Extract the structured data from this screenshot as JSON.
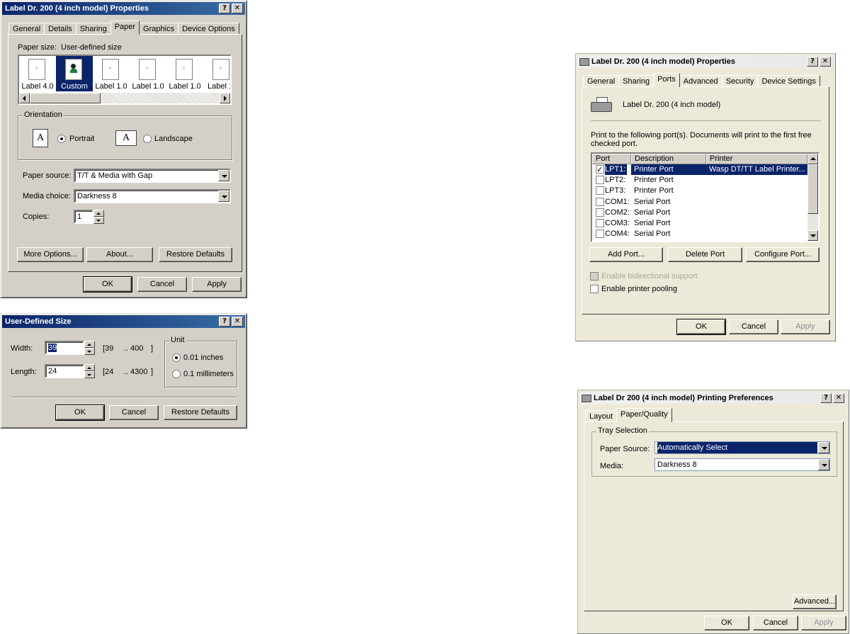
{
  "win1": {
    "title": "Label Dr. 200 (4 inch model) Properties",
    "help": "?",
    "close": "✕",
    "tabs": [
      "General",
      "Details",
      "Sharing",
      "Paper",
      "Graphics",
      "Device Options"
    ],
    "paper_size_label": "Paper size:",
    "paper_size_value": "User-defined size",
    "papers": [
      "Label 4.0",
      "Custom",
      "Label 1.0",
      "Label 1.0",
      "Label 1.0",
      "Label 1"
    ],
    "orientation_label": "Orientation",
    "portrait": "Portrait",
    "landscape": "Landscape",
    "orient_glyph": "A",
    "paper_source_label": "Paper source:",
    "paper_source_value": "T/T & Media with Gap",
    "media_label": "Media choice:",
    "media_value": "Darkness 8",
    "copies_label": "Copies:",
    "copies_value": "1",
    "more_options": "More Options...",
    "about": "About...",
    "restore": "Restore Defaults",
    "ok": "OK",
    "cancel": "Cancel",
    "apply": "Apply"
  },
  "win2": {
    "title": "User-Defined Size",
    "help": "?",
    "close": "✕",
    "width_label": "Width:",
    "width_value": "39",
    "width_range_lo": "[39",
    "width_range_sep": "..",
    "width_range_hi": "400",
    "range_close": "]",
    "length_label": "Length:",
    "length_value": "24",
    "length_range_lo": "[24",
    "length_range_sep": "..",
    "length_range_hi": "4300",
    "unit_label": "Unit",
    "unit_inch": "0.01 inches",
    "unit_mm": "0.1 millimeters",
    "ok": "OK",
    "cancel": "Cancel",
    "restore": "Restore Defaults"
  },
  "win3": {
    "title": "Label Dr. 200 (4 inch model) Properties",
    "help": "?",
    "close": "✕",
    "tabs": [
      "General",
      "Sharing",
      "Ports",
      "Advanced",
      "Security",
      "Device Settings"
    ],
    "printer_name": "Label Dr. 200 (4 inch model)",
    "instructions_1": "Print to the following port(s). Documents will print to the first free",
    "instructions_2": "checked port.",
    "columns": [
      "Port",
      "Description",
      "Printer"
    ],
    "ports": [
      {
        "port": "LPT1:",
        "desc": "Printer Port",
        "printer": "Wasp DT/TT Label Printer..."
      },
      {
        "port": "LPT2:",
        "desc": "Printer Port",
        "printer": ""
      },
      {
        "port": "LPT3:",
        "desc": "Printer Port",
        "printer": ""
      },
      {
        "port": "COM1:",
        "desc": "Serial Port",
        "printer": ""
      },
      {
        "port": "COM2:",
        "desc": "Serial Port",
        "printer": ""
      },
      {
        "port": "COM3:",
        "desc": "Serial Port",
        "printer": ""
      },
      {
        "port": "COM4:",
        "desc": "Serial Port",
        "printer": ""
      }
    ],
    "add_port": "Add Port...",
    "delete_port": "Delete Port",
    "configure_port": "Configure Port...",
    "bidirectional": "Enable bidirectional support",
    "pooling": "Enable printer pooling",
    "ok": "OK",
    "cancel": "Cancel",
    "apply": "Apply"
  },
  "win4": {
    "title": "Label Dr 200 (4 inch model) Printing Preferences",
    "help": "?",
    "close": "✕",
    "tabs": [
      "Layout",
      "Paper/Quality"
    ],
    "tray_label": "Tray Selection",
    "paper_source_label": "Paper Source:",
    "paper_source_value": "Automatically Select",
    "media_label": "Media:",
    "media_value": "Darkness 8",
    "advanced": "Advanced...",
    "ok": "OK",
    "cancel": "Cancel",
    "apply": "Apply"
  }
}
